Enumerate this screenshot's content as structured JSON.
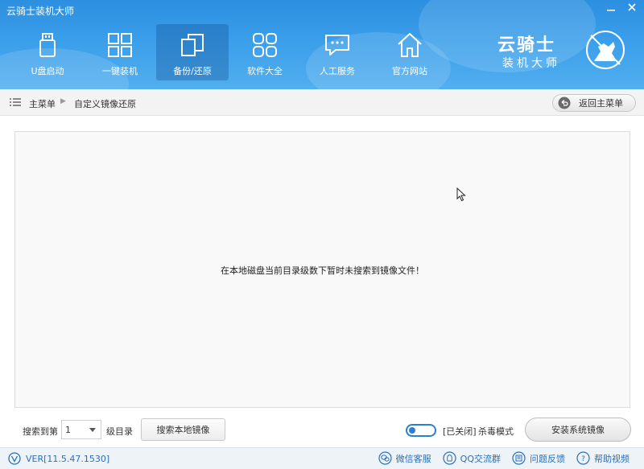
{
  "window": {
    "title": "云骑士装机大师",
    "minimize_icon": "minimize-icon",
    "close_icon": "close-icon"
  },
  "nav": {
    "items": [
      {
        "label": "U盘启动",
        "icon": "usb-drive-icon",
        "active": false
      },
      {
        "label": "一键装机",
        "icon": "windows-logo-icon",
        "active": false
      },
      {
        "label": "备份/还原",
        "icon": "backup-restore-icon",
        "active": true
      },
      {
        "label": "软件大全",
        "icon": "apps-grid-icon",
        "active": false
      },
      {
        "label": "人工服务",
        "icon": "chat-bubble-icon",
        "active": false
      },
      {
        "label": "官方网站",
        "icon": "home-icon",
        "active": false
      }
    ]
  },
  "logo": {
    "line1": "云骑士",
    "line2": "装机大师",
    "icon": "knight-horse-logo"
  },
  "breadcrumb": {
    "home": "主菜单",
    "current": "自定义镜像还原",
    "back_label": "返回主菜单"
  },
  "panel": {
    "empty_message": "在本地磁盘当前目录级数下暂时未搜索到镜像文件！"
  },
  "controls": {
    "search_prefix": "搜索到第",
    "search_level_value": "1",
    "search_suffix": "级目录",
    "search_button": "搜索本地镜像",
    "antivirus_state": "[已关闭]",
    "antivirus_label": "杀毒模式",
    "install_button": "安装系统镜像"
  },
  "status": {
    "version": "VER[11.5.47.1530]",
    "links": [
      {
        "label": "微信客服",
        "icon": "wechat-icon"
      },
      {
        "label": "QQ交流群",
        "icon": "qq-icon"
      },
      {
        "label": "问题反馈",
        "icon": "feedback-icon"
      },
      {
        "label": "帮助视频",
        "icon": "help-icon"
      }
    ]
  },
  "colors": {
    "header": "#3a9eea",
    "accent": "#2a7fd4",
    "link": "#2a6fbb"
  }
}
